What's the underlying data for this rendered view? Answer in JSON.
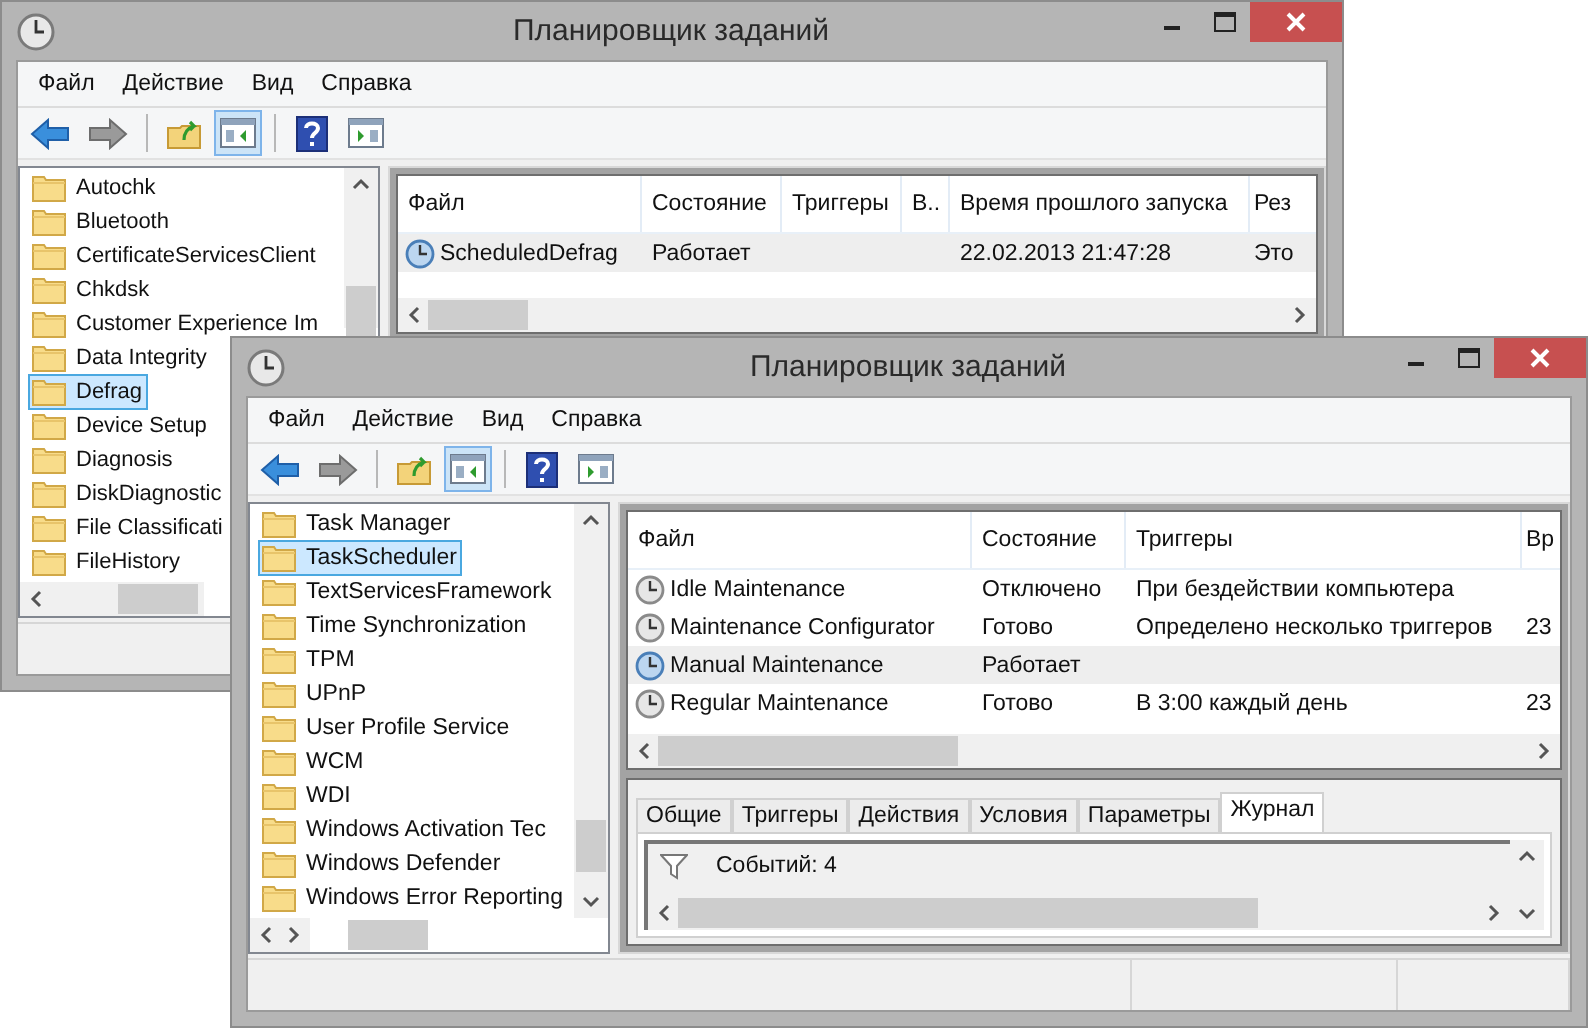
{
  "windows": [
    {
      "title": "Планировщик заданий",
      "menu": [
        "Файл",
        "Действие",
        "Вид",
        "Справка"
      ],
      "toolbar": [
        {
          "kind": "back",
          "pressed": false
        },
        {
          "kind": "forward",
          "pressed": false
        },
        {
          "kind": "up",
          "pressed": false
        },
        {
          "kind": "tree",
          "pressed": true
        },
        {
          "kind": "help",
          "pressed": false
        },
        {
          "kind": "pane",
          "pressed": false
        }
      ],
      "tree": [
        {
          "label": "Autochk",
          "selected": false
        },
        {
          "label": "Bluetooth",
          "selected": false
        },
        {
          "label": "CertificateServicesClient",
          "selected": false
        },
        {
          "label": "Chkdsk",
          "selected": false
        },
        {
          "label": "Customer Experience Im",
          "selected": false
        },
        {
          "label": "Data Integrity",
          "selected": false
        },
        {
          "label": "Defrag",
          "selected": true
        },
        {
          "label": "Device Setup",
          "selected": false
        },
        {
          "label": "Diagnosis",
          "selected": false
        },
        {
          "label": "DiskDiagnostic",
          "selected": false
        },
        {
          "label": "File Classificati",
          "selected": false
        },
        {
          "label": "FileHistory",
          "selected": false
        }
      ],
      "table": {
        "columns": [
          "Файл",
          "Состояние",
          "Триггеры",
          "В..",
          "Время прошлого запуска",
          "Рез"
        ],
        "rows": [
          {
            "cells": [
              "ScheduledDefrag",
              "Работает",
              null,
              null,
              "22.02.2013 21:47:28",
              "Это"
            ],
            "running": true,
            "selected": true
          }
        ]
      }
    },
    {
      "title": "Планировщик заданий",
      "menu": [
        "Файл",
        "Действие",
        "Вид",
        "Справка"
      ],
      "toolbar": [
        {
          "kind": "back",
          "pressed": false
        },
        {
          "kind": "forward",
          "pressed": false
        },
        {
          "kind": "up",
          "pressed": false
        },
        {
          "kind": "tree",
          "pressed": true
        },
        {
          "kind": "help",
          "pressed": false
        },
        {
          "kind": "pane",
          "pressed": false
        }
      ],
      "tree": [
        {
          "label": "Task Manager",
          "selected": false
        },
        {
          "label": "TaskScheduler",
          "selected": true
        },
        {
          "label": "TextServicesFramework",
          "selected": false
        },
        {
          "label": "Time Synchronization",
          "selected": false
        },
        {
          "label": "TPM",
          "selected": false
        },
        {
          "label": "UPnP",
          "selected": false
        },
        {
          "label": "User Profile Service",
          "selected": false
        },
        {
          "label": "WCM",
          "selected": false
        },
        {
          "label": "WDI",
          "selected": false
        },
        {
          "label": "Windows Activation Tec",
          "selected": false
        },
        {
          "label": "Windows Defender",
          "selected": false
        },
        {
          "label": "Windows Error Reporting",
          "selected": false
        }
      ],
      "table": {
        "columns": [
          "Файл",
          "Состояние",
          "Триггеры",
          "Вр"
        ],
        "rows": [
          {
            "cells": [
              "Idle Maintenance",
              "Отключено",
              "При бездействии компьютера",
              null
            ],
            "running": false,
            "selected": false
          },
          {
            "cells": [
              "Maintenance Configurator",
              "Готово",
              "Определено несколько триггеров",
              "23"
            ],
            "running": false,
            "selected": false
          },
          {
            "cells": [
              "Manual Maintenance",
              "Работает",
              null,
              null
            ],
            "running": true,
            "selected": true
          },
          {
            "cells": [
              "Regular Maintenance",
              "Готово",
              "В 3:00 каждый день",
              "23"
            ],
            "running": false,
            "selected": false
          }
        ]
      },
      "details": {
        "tabs": [
          {
            "label": "Общие",
            "selected": false
          },
          {
            "label": "Триггеры",
            "selected": false
          },
          {
            "label": "Действия",
            "selected": false
          },
          {
            "label": "Условия",
            "selected": false
          },
          {
            "label": "Параметры",
            "selected": false
          },
          {
            "label": "Журнал",
            "selected": true
          }
        ],
        "log_summary": "Событий: 4"
      }
    }
  ]
}
